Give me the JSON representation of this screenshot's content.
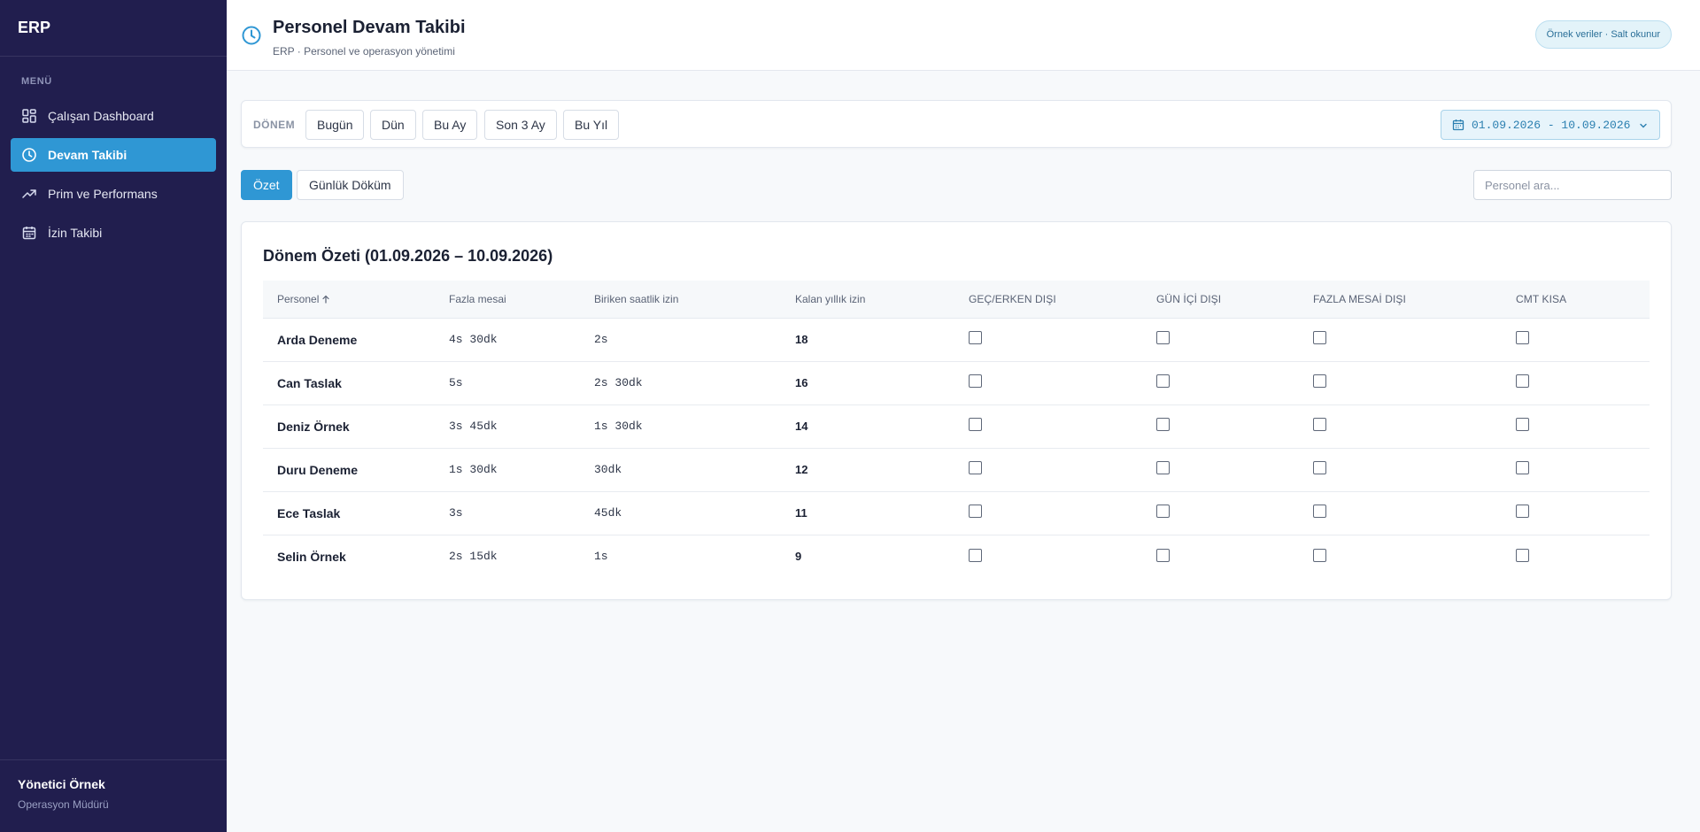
{
  "sidebar": {
    "brand": "ERP",
    "menu_label": "MENÜ",
    "items": [
      {
        "label": "Çalışan Dashboard",
        "icon": "dashboard-icon",
        "active": false
      },
      {
        "label": "Devam Takibi",
        "icon": "clock-icon",
        "active": true
      },
      {
        "label": "Prim ve Performans",
        "icon": "trending-up-icon",
        "active": false
      },
      {
        "label": "İzin Takibi",
        "icon": "calendar-icon",
        "active": false
      }
    ],
    "user": {
      "name": "Yönetici Örnek",
      "role": "Operasyon Müdürü"
    }
  },
  "header": {
    "title": "Personel Devam Takibi",
    "subtitle": "ERP · Personel ve operasyon yönetimi",
    "badge": "Örnek veriler · Salt okunur"
  },
  "period": {
    "label": "DÖNEM",
    "buttons": [
      "Bugün",
      "Dün",
      "Bu Ay",
      "Son 3 Ay",
      "Bu Yıl"
    ],
    "date_range": "01.09.2026 - 10.09.2026"
  },
  "tabs": {
    "summary": "Özet",
    "daily": "Günlük Döküm"
  },
  "search": {
    "placeholder": "Personel ara..."
  },
  "card": {
    "title": "Dönem Özeti (01.09.2026 – 10.09.2026)",
    "columns": [
      "Personel",
      "Fazla mesai",
      "Biriken saatlik izin",
      "Kalan yıllık izin",
      "GEÇ/ERKEN DIŞI",
      "GÜN İÇİ DIŞI",
      "FAZLA MESAİ DIŞI",
      "CMT KISA"
    ],
    "rows": [
      {
        "name": "Arda Deneme",
        "overtime": "4s 30dk",
        "hourly_leave": "2s",
        "annual_leave": "18",
        "late_early": false,
        "intraday": false,
        "overtime_ex": false,
        "sat_short": false
      },
      {
        "name": "Can Taslak",
        "overtime": "5s",
        "hourly_leave": "2s 30dk",
        "annual_leave": "16",
        "late_early": false,
        "intraday": false,
        "overtime_ex": false,
        "sat_short": false
      },
      {
        "name": "Deniz Örnek",
        "overtime": "3s 45dk",
        "hourly_leave": "1s 30dk",
        "annual_leave": "14",
        "late_early": false,
        "intraday": false,
        "overtime_ex": false,
        "sat_short": false
      },
      {
        "name": "Duru Deneme",
        "overtime": "1s 30dk",
        "hourly_leave": "30dk",
        "annual_leave": "12",
        "late_early": false,
        "intraday": false,
        "overtime_ex": false,
        "sat_short": false
      },
      {
        "name": "Ece Taslak",
        "overtime": "3s",
        "hourly_leave": "45dk",
        "annual_leave": "11",
        "late_early": false,
        "intraday": false,
        "overtime_ex": false,
        "sat_short": false
      },
      {
        "name": "Selin Örnek",
        "overtime": "2s 15dk",
        "hourly_leave": "1s",
        "annual_leave": "9",
        "late_early": false,
        "intraday": false,
        "overtime_ex": false,
        "sat_short": false
      }
    ]
  },
  "colors": {
    "sidebar_bg": "#211e4e",
    "accent": "#2f97d4",
    "page_bg": "#f7f9fb"
  }
}
